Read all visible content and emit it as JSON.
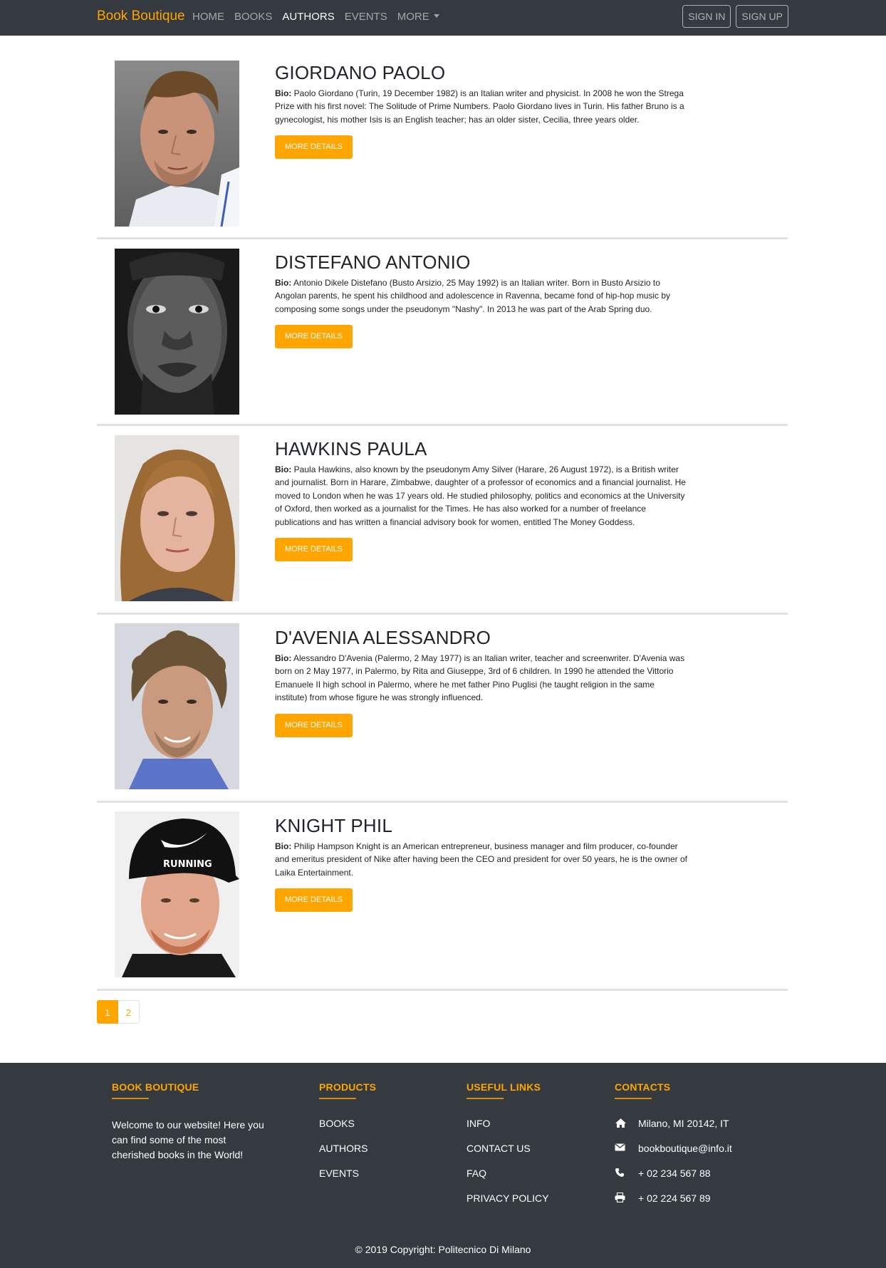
{
  "nav": {
    "brand": "Book Boutique",
    "links": [
      "HOME",
      "BOOKS",
      "AUTHORS",
      "EVENTS",
      "MORE"
    ],
    "active": "AUTHORS",
    "sign_in": "SIGN IN",
    "sign_up": "SIGN UP"
  },
  "authors": [
    {
      "name": "GIORDANO PAOLO",
      "bio_label": "Bio:",
      "bio": "Paolo Giordano (Turin, 19 December 1982) is an Italian writer and physicist. In 2008 he won the Strega Prize with his first novel: The Solitude of Prime Numbers. Paolo Giordano lives in Turin. His father Bruno is a gynecologist, his mother Isis is an English teacher; has an older sister, Cecilia, three years older.",
      "button": "MORE DETAILS"
    },
    {
      "name": "DISTEFANO ANTONIO",
      "bio_label": "Bio:",
      "bio": "Antonio Dikele Distefano (Busto Arsizio, 25 May 1992) is an Italian writer. Born in Busto Arsizio to Angolan parents, he spent his childhood and adolescence in Ravenna, became fond of hip-hop music by composing some songs under the pseudonym \"Nashy\". In 2013 he was part of the Arab Spring duo.",
      "button": "MORE DETAILS"
    },
    {
      "name": "HAWKINS PAULA",
      "bio_label": "Bio:",
      "bio": "Paula Hawkins, also known by the pseudonym Amy Silver (Harare, 26 August 1972), is a British writer and journalist. Born in Harare, Zimbabwe, daughter of a professor of economics and a financial journalist. He moved to London when he was 17 years old. He studied philosophy, politics and economics at the University of Oxford, then worked as a journalist for the Times. He has also worked for a number of freelance publications and has written a financial advisory book for women, entitled The Money Goddess.",
      "button": "MORE DETAILS"
    },
    {
      "name": "D'AVENIA ALESSANDRO",
      "bio_label": "Bio:",
      "bio": "Alessandro D'Avenia (Palermo, 2 May 1977) is an Italian writer, teacher and screenwriter. D'Avenia was born on 2 May 1977, in Palermo, by Rita and Giuseppe, 3rd of 6 children. In 1990 he attended the Vittorio Emanuele II high school in Palermo, where he met father Pino Puglisi (he taught religion in the same institute) from whose figure he was strongly influenced.",
      "button": "MORE DETAILS"
    },
    {
      "name": "KNIGHT PHIL",
      "bio_label": "Bio:",
      "bio": "Philip Hampson Knight is an American entrepreneur, business manager and film producer, co-founder and emeritus president of Nike after having been the CEO and president for over 50 years, he is the owner of Laika Entertainment.",
      "button": "MORE DETAILS",
      "cap_text": "RUNNING"
    }
  ],
  "pagination": [
    "1",
    "2"
  ],
  "footer": {
    "about_title": "BOOK BOUTIQUE",
    "about_text": "Welcome to our website! Here you can find some of the most cherished books in the World!",
    "products_title": "PRODUCTS",
    "products": [
      "BOOKS",
      "AUTHORS",
      "EVENTS"
    ],
    "links_title": "USEFUL LINKS",
    "links": [
      "INFO",
      "CONTACT US",
      "FAQ",
      "PRIVACY POLICY"
    ],
    "contacts_title": "CONTACTS",
    "contacts": [
      {
        "icon": "home-icon",
        "text": "Milano, MI 20142, IT"
      },
      {
        "icon": "envelope-icon",
        "text": "bookboutique@info.it"
      },
      {
        "icon": "phone-icon",
        "text": "+ 02 234 567 88"
      },
      {
        "icon": "printer-icon",
        "text": "+ 02 224 567 89"
      }
    ],
    "copyright": "© 2019 Copyright: Politecnico Di Milano"
  },
  "colors": {
    "accent": "#ffa500",
    "navbar": "#343a40",
    "footer": "#343a40"
  }
}
